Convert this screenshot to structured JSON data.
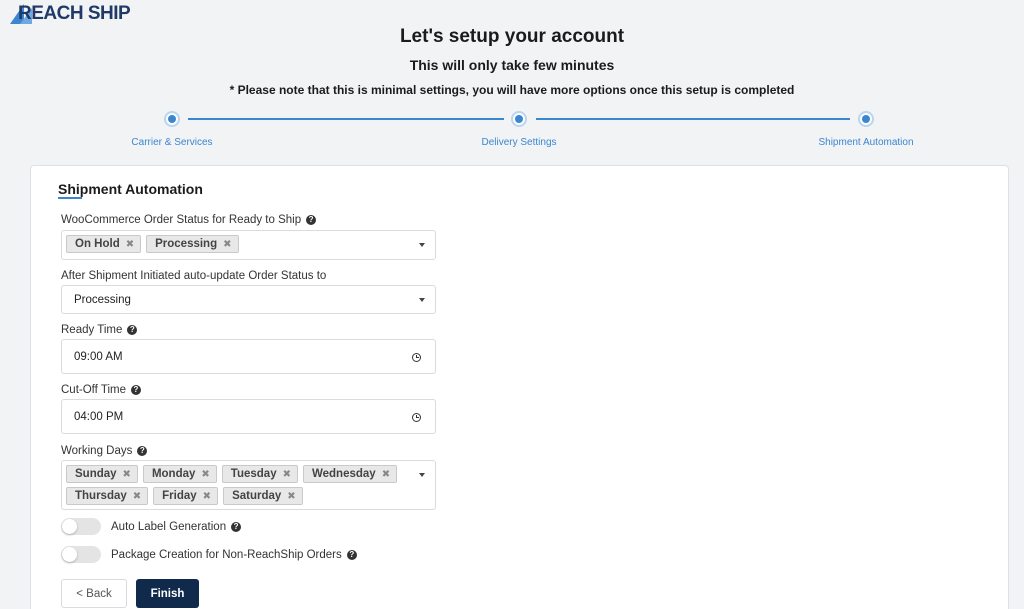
{
  "brand": {
    "name": "REACH SHIP",
    "primary_color": "#1f3a68",
    "accent_color": "#3b86d1"
  },
  "header": {
    "title": "Let's setup your account",
    "subtitle": "This will only take few minutes",
    "note": "* Please note that this is minimal settings, you will have more options once this setup is completed"
  },
  "stepper": {
    "steps": [
      {
        "label": "Carrier & Services"
      },
      {
        "label": "Delivery Settings"
      },
      {
        "label": "Shipment Automation"
      }
    ]
  },
  "form": {
    "section_title": "Shipment Automation",
    "ready_status": {
      "label": "WooCommerce Order Status for Ready to Ship",
      "tags": [
        "On Hold",
        "Processing"
      ]
    },
    "after_initiated": {
      "label": "After Shipment Initiated auto-update Order Status to",
      "value": "Processing"
    },
    "ready_time": {
      "label": "Ready Time",
      "value": "09:00 AM"
    },
    "cutoff_time": {
      "label": "Cut-Off Time",
      "value": "04:00 PM"
    },
    "working_days": {
      "label": "Working Days",
      "tags": [
        "Sunday",
        "Monday",
        "Tuesday",
        "Wednesday",
        "Thursday",
        "Friday",
        "Saturday"
      ]
    },
    "auto_label": {
      "label": "Auto Label Generation",
      "enabled": false
    },
    "package_creation": {
      "label": "Package Creation for Non-ReachShip Orders",
      "enabled": false
    }
  },
  "buttons": {
    "back": "< Back",
    "finish": "Finish"
  },
  "icons": {
    "help": "help-icon",
    "clock": "clock-icon",
    "dropdown": "chevron-down-icon",
    "remove": "close-icon"
  },
  "glyphs": {
    "help": "?",
    "remove": "✖"
  }
}
